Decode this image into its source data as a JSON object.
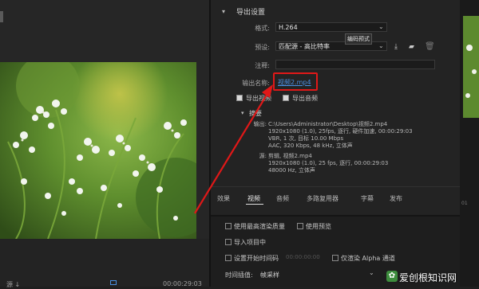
{
  "export": {
    "section_title": "导出设置",
    "format_label": "格式:",
    "format_value": "H.264",
    "preset_label": "预设:",
    "preset_value": "匹配源 - 高比特率",
    "preset_tooltip": "编码预式",
    "comment_label": "注释:",
    "output_name_label": "输出名称:",
    "output_name_value": "视频2.mp4",
    "export_video_label": "导出视频",
    "export_audio_label": "导出音频"
  },
  "summary": {
    "title": "摘要",
    "output_label": "输出:",
    "output_lines": [
      "C:\\Users\\Administrator\\Desktop\\视频2.mp4",
      "1920x1080 (1.0), 25fps, 逐行, 硬件加速, 00:00:29:03",
      "VBR, 1 次, 目标 10.00 Mbps",
      "AAC, 320 Kbps, 48 kHz, 立体声"
    ],
    "source_label": "源:",
    "source_lines": [
      "剪辑, 视频2.mp4",
      "1920x1080 (1.0), 25 fps, 逐行, 00:00:29:03",
      "48000 Hz, 立体声"
    ]
  },
  "tabs": [
    "效果",
    "视频",
    "音频",
    "多路复用器",
    "字幕",
    "发布"
  ],
  "options": {
    "max_render_quality": "使用最高渲染质量",
    "use_previews": "使用预览",
    "import_into_project": "导入项目中",
    "set_start_timecode": "设置开始时间码",
    "start_timecode_value": "00:00:00:00",
    "render_alpha": "仅渲染 Alpha 通道",
    "time_interp_label": "时间插值:",
    "time_interp_value": "帧采样"
  },
  "left": {
    "bottom_label": "源 ↓",
    "timecode": "00:00:29:03"
  },
  "watermark": {
    "text": "爱创根知识网"
  },
  "colors": {
    "highlight": "#e01818",
    "arrow": "#e01818",
    "link_blue": "#4a90e2"
  }
}
